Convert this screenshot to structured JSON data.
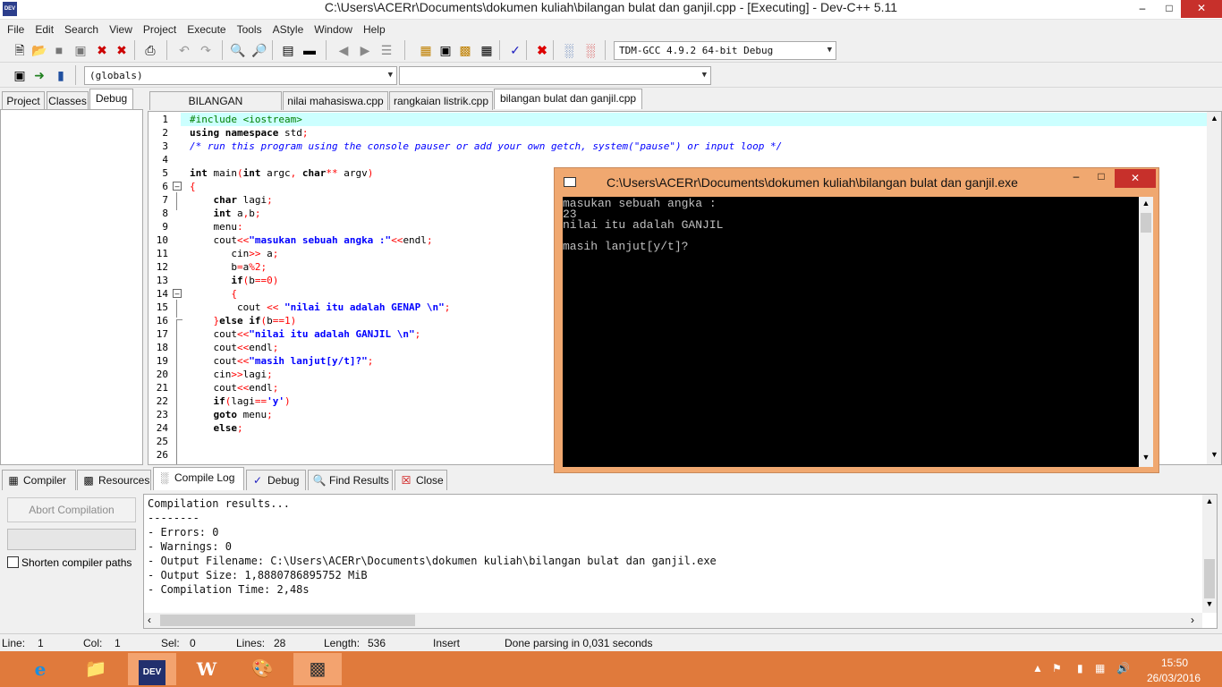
{
  "window": {
    "title": "C:\\Users\\ACERr\\Documents\\dokumen kuliah\\bilangan bulat dan ganjil.cpp - [Executing] - Dev-C++ 5.11",
    "app_icon_text": "DEV"
  },
  "menu": [
    "File",
    "Edit",
    "Search",
    "View",
    "Project",
    "Execute",
    "Tools",
    "AStyle",
    "Window",
    "Help"
  ],
  "toolbar": {
    "compiler_select": "TDM-GCC 4.9.2 64-bit Debug",
    "scope_select": "(globals)",
    "member_select": ""
  },
  "left_tabs": [
    "Project",
    "Classes",
    "Debug"
  ],
  "file_tabs": [
    "BILANGAN TERBESAR.cpp",
    "nilai mahasiswa.cpp",
    "rangkaian listrik.cpp",
    "bilangan bulat dan ganjil.cpp"
  ],
  "editor": {
    "line_numbers": [
      "1",
      "2",
      "3",
      "4",
      "5",
      "6",
      "7",
      "8",
      "9",
      "10",
      "11",
      "12",
      "13",
      "14",
      "15",
      "16",
      "17",
      "18",
      "19",
      "20",
      "21",
      "22",
      "23",
      "24",
      "25",
      "26"
    ]
  },
  "console": {
    "title": "C:\\Users\\ACERr\\Documents\\dokumen kuliah\\bilangan bulat dan ganjil.exe",
    "lines": [
      "masukan sebuah angka :",
      "23",
      "nilai itu adalah GANJIL",
      "",
      "masih lanjut[y/t]?"
    ]
  },
  "bottom_tabs": [
    "Compiler",
    "Resources",
    "Compile Log",
    "Debug",
    "Find Results",
    "Close"
  ],
  "log_panel": {
    "abort_button": "Abort Compilation",
    "shorten_checkbox": "Shorten compiler paths",
    "lines": [
      "Compilation results...",
      "--------",
      "- Errors: 0",
      "- Warnings: 0",
      "- Output Filename: C:\\Users\\ACERr\\Documents\\dokumen kuliah\\bilangan bulat dan ganjil.exe",
      "- Output Size: 1,8880786895752 MiB",
      "- Compilation Time: 2,48s"
    ]
  },
  "status": {
    "line_label": "Line:",
    "line_value": "1",
    "col_label": "Col:",
    "col_value": "1",
    "sel_label": "Sel:",
    "sel_value": "0",
    "lines_label": "Lines:",
    "lines_value": "28",
    "length_label": "Length:",
    "length_value": "536",
    "mode": "Insert",
    "message": "Done parsing in 0,031 seconds"
  },
  "taskbar": {
    "time": "15:50",
    "date": "26/03/2016",
    "dev_label": "DEV"
  },
  "colors": {
    "taskbar": "#e07a3c",
    "console_frame": "#f0a870",
    "current_line": "#ccffff",
    "keyword_string": "#0000ff",
    "preprocessor": "#008000",
    "symbol": "#ff0000"
  }
}
